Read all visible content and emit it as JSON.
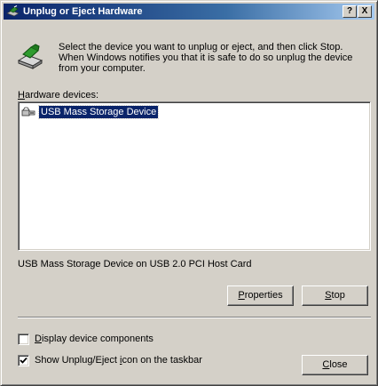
{
  "window": {
    "title": "Unplug or Eject Hardware",
    "help_label": "?",
    "close_label": "X"
  },
  "intro": {
    "text": "Select the device you want to unplug or eject, and then click Stop. When Windows notifies you that it is safe to do so unplug the device from your computer."
  },
  "hardware": {
    "label_accel": "H",
    "label_rest": "ardware devices:",
    "items": [
      {
        "label": "USB Mass Storage Device",
        "icon": "usb-plug-icon",
        "selected": true
      }
    ],
    "selected_description": "USB Mass Storage Device on USB 2.0 PCI Host Card"
  },
  "buttons": {
    "properties_accel": "P",
    "properties_rest": "roperties",
    "stop_accel": "S",
    "stop_rest": "top",
    "close_accel": "C",
    "close_rest": "lose"
  },
  "options": {
    "display_components_accel": "D",
    "display_components_rest": "isplay device components",
    "display_components_checked": false,
    "show_icon_pre": "Show Unplug/Eject ",
    "show_icon_accel": "i",
    "show_icon_post": "con on the taskbar",
    "show_icon_checked": true
  },
  "colors": {
    "title_active": "#0a246a",
    "face": "#d4d0c8",
    "selection": "#0a246a"
  }
}
